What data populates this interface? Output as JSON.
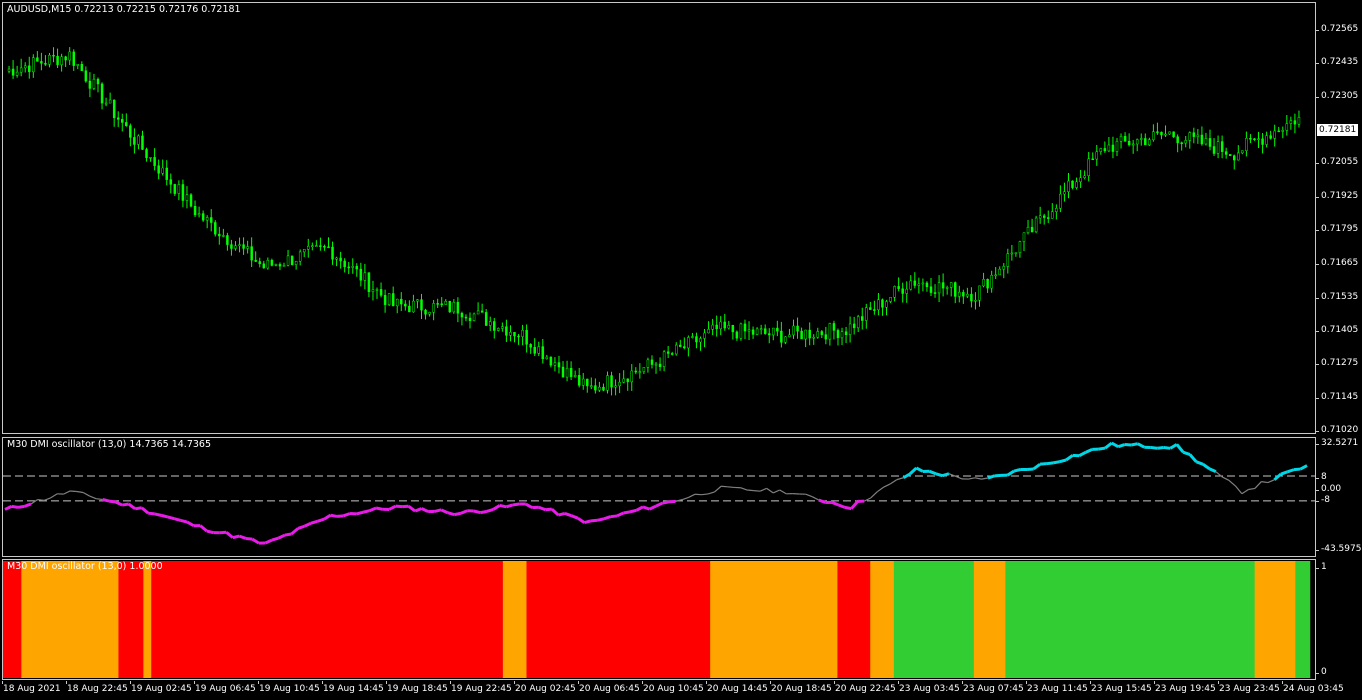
{
  "main": {
    "label": "AUDUSD,M15  0.72213 0.72215 0.72176 0.72181",
    "current_price": "0.72181",
    "price_axis": [
      "0.72565",
      "0.72435",
      "0.72305",
      "0.72055",
      "0.71925",
      "0.71795",
      "0.71665",
      "0.71535",
      "0.71405",
      "0.71275",
      "0.71145",
      "0.71020"
    ],
    "candle_color": "#00ff00"
  },
  "oscillator": {
    "label": "M30 DMI oscillator (13,0) 14.7365 14.7365",
    "axis": [
      "32.5271",
      "8",
      "0.00",
      "-8",
      "-43.5975"
    ],
    "colors": {
      "bull": "#00d7e6",
      "bear": "#e81ce8",
      "neutral": "#808080"
    }
  },
  "histogram": {
    "label": "M30 DMI oscillator (13,0) 1.0000",
    "axis": [
      "1",
      "0"
    ],
    "colors": {
      "red": "#ff0000",
      "orange": "#ffa500",
      "green": "#32cd32"
    }
  },
  "time_axis": [
    "18 Aug 2021",
    "18 Aug 22:45",
    "19 Aug 02:45",
    "19 Aug 06:45",
    "19 Aug 10:45",
    "19 Aug 14:45",
    "19 Aug 18:45",
    "19 Aug 22:45",
    "20 Aug 02:45",
    "20 Aug 06:45",
    "20 Aug 10:45",
    "20 Aug 14:45",
    "20 Aug 18:45",
    "20 Aug 22:45",
    "23 Aug 03:45",
    "23 Aug 07:45",
    "23 Aug 11:45",
    "23 Aug 15:45",
    "23 Aug 19:45",
    "23 Aug 23:45",
    "24 Aug 03:45"
  ],
  "chart_data": [
    {
      "type": "line",
      "title": "AUDUSD,M15",
      "description_values": {
        "open": 0.72213,
        "high": 0.72215,
        "low": 0.72176,
        "close": 0.72181
      },
      "x": [
        "18 Aug 2021",
        "18 Aug 22:45",
        "19 Aug 02:45",
        "19 Aug 06:45",
        "19 Aug 10:45",
        "19 Aug 14:45",
        "19 Aug 18:45",
        "19 Aug 22:45",
        "20 Aug 02:45",
        "20 Aug 06:45",
        "20 Aug 10:45",
        "20 Aug 14:45",
        "20 Aug 18:45",
        "20 Aug 22:45",
        "23 Aug 03:45",
        "23 Aug 07:45",
        "23 Aug 11:45",
        "23 Aug 15:45",
        "23 Aug 19:45",
        "23 Aug 23:45",
        "24 Aug 03:45"
      ],
      "series": [
        {
          "values": [
            0.7235,
            0.7241,
            0.721,
            0.7182,
            0.7163,
            0.717,
            0.7149,
            0.7148,
            0.7138,
            0.7118,
            0.7127,
            0.714,
            0.7138,
            0.714,
            0.7158,
            0.7153,
            0.718,
            0.7207,
            0.7212,
            0.7205,
            0.7218
          ]
        }
      ],
      "ylim": [
        0.7102,
        0.726
      ]
    },
    {
      "type": "line",
      "title": "M30 DMI oscillator (13,0)",
      "x": [
        "18 Aug 2021",
        "18 Aug 22:45",
        "19 Aug 02:45",
        "19 Aug 06:45",
        "19 Aug 10:45",
        "19 Aug 14:45",
        "19 Aug 18:45",
        "19 Aug 22:45",
        "20 Aug 02:45",
        "20 Aug 06:45",
        "20 Aug 10:45",
        "20 Aug 14:45",
        "20 Aug 18:45",
        "20 Aug 22:45",
        "23 Aug 03:45",
        "23 Aug 07:45",
        "23 Aug 11:45",
        "23 Aug 15:45",
        "23 Aug 19:45",
        "23 Aug 23:45",
        "24 Aug 03:45"
      ],
      "series": [
        {
          "values": [
            -14,
            -2,
            -12,
            -25,
            -36,
            -18,
            -12,
            -16,
            -10,
            -22,
            -11,
            0,
            -2,
            -12,
            12,
            5,
            16,
            28,
            27,
            -2,
            14.7365
          ]
        }
      ],
      "ylim": [
        -43.5975,
        32.5271
      ],
      "levels": [
        8,
        0,
        -8
      ]
    },
    {
      "type": "bar",
      "title": "M30 DMI oscillator (13,0)",
      "segments": [
        {
          "state": "red",
          "from": 0,
          "to": 0.014
        },
        {
          "state": "orange",
          "from": 0.014,
          "to": 0.088
        },
        {
          "state": "red",
          "from": 0.088,
          "to": 0.107
        },
        {
          "state": "orange",
          "from": 0.107,
          "to": 0.113
        },
        {
          "state": "red",
          "from": 0.113,
          "to": 0.381
        },
        {
          "state": "orange",
          "from": 0.381,
          "to": 0.399
        },
        {
          "state": "red",
          "from": 0.399,
          "to": 0.539
        },
        {
          "state": "orange",
          "from": 0.539,
          "to": 0.636
        },
        {
          "state": "red",
          "from": 0.636,
          "to": 0.661
        },
        {
          "state": "orange",
          "from": 0.661,
          "to": 0.679
        },
        {
          "state": "green",
          "from": 0.679,
          "to": 0.74
        },
        {
          "state": "orange",
          "from": 0.74,
          "to": 0.764
        },
        {
          "state": "green",
          "from": 0.764,
          "to": 0.954
        },
        {
          "state": "orange",
          "from": 0.954,
          "to": 0.985
        },
        {
          "state": "green",
          "from": 0.985,
          "to": 0.996
        }
      ],
      "ylim": [
        0,
        1
      ],
      "value": 1.0
    }
  ]
}
